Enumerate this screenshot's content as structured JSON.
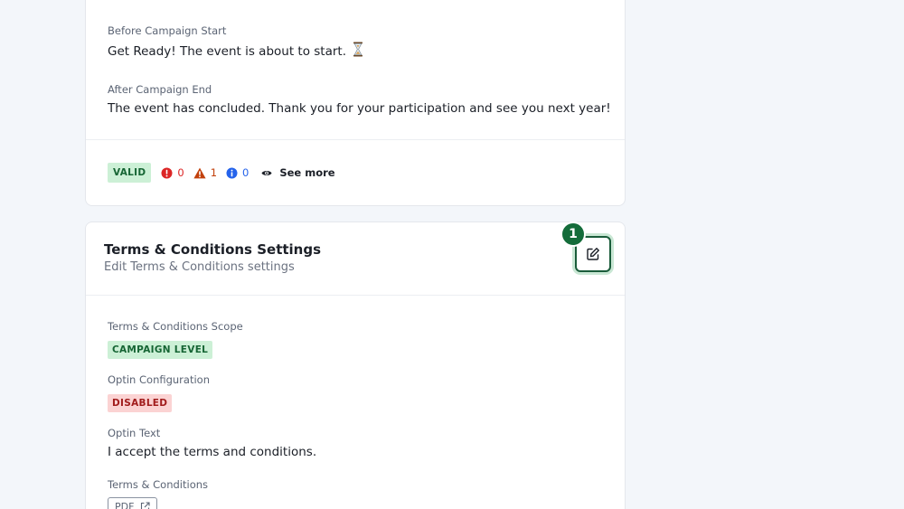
{
  "messages": {
    "before_start": {
      "label": "Before Campaign Start",
      "value": "Get Ready! The event is about to start.",
      "icon": "hourglass-icon"
    },
    "after_end": {
      "label": "After Campaign End",
      "value": "The event has concluded. Thank you for your participation and see you next year!"
    }
  },
  "validation": {
    "status": "VALID",
    "errors": "0",
    "warnings": "1",
    "infos": "0",
    "see_more_label": "See more"
  },
  "terms_settings": {
    "title": "Terms & Conditions Settings",
    "subtitle": "Edit Terms & Conditions settings",
    "step_number": "1",
    "edit_icon": "edit-icon",
    "fields": {
      "scope": {
        "label": "Terms & Conditions Scope",
        "value": "CAMPAIGN LEVEL"
      },
      "optin_config": {
        "label": "Optin Configuration",
        "value": "DISABLED"
      },
      "optin_text": {
        "label": "Optin Text",
        "value": "I accept the terms and conditions."
      },
      "terms": {
        "label": "Terms & Conditions",
        "link_label": "PDF",
        "link_icon": "external-link-icon"
      }
    }
  },
  "colors": {
    "valid_bg": "#ccf0d6",
    "valid_text": "#166534",
    "disabled_bg": "#fbd3d3",
    "disabled_text": "#a11c1c",
    "error": "#dc2626",
    "warning": "#c2410c",
    "info": "#2563eb",
    "accent": "#146c3a"
  }
}
